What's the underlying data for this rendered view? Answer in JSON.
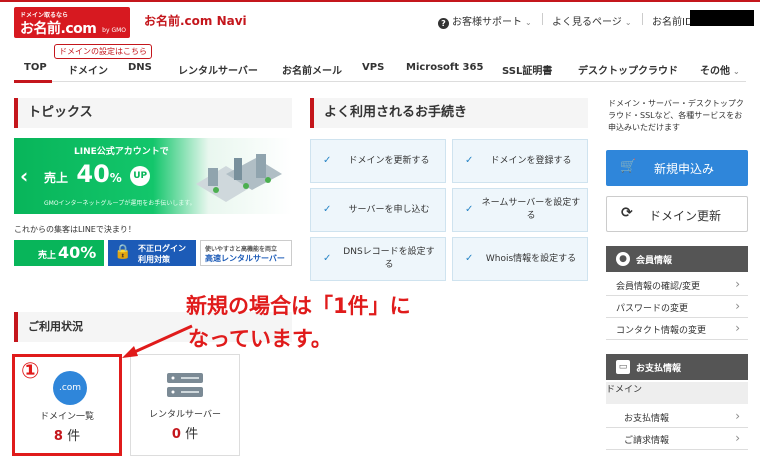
{
  "header": {
    "logo_top": "ドメイン取るなら",
    "logo_main": "お名前.com",
    "logo_sub": "by GMO",
    "app_title": "お名前.com Navi",
    "support_label": "お客様サポート",
    "frequent_label": "よく見るページ",
    "id_label": "お名前ID"
  },
  "domain_tip": "ドメインの設定はこちら",
  "nav": {
    "tabs": [
      "TOP",
      "ドメイン",
      "DNS",
      "レンタルサーバー",
      "お名前メール",
      "VPS",
      "Microsoft 365",
      "SSL証明書",
      "デスクトップクラウド",
      "その他"
    ]
  },
  "topics": {
    "title": "トピックス",
    "banner_line1": "LINE公式アカウントで",
    "banner_line2a": "売上",
    "banner_line2b": "40",
    "banner_line2c": "%",
    "banner_up": "UP",
    "banner_line3": "GMOインターネットグループが運用をお手伝いします。",
    "line_text": "これからの集客はLINEで決まり！",
    "mini1_a": "売上",
    "mini1_b": "40%",
    "mini2_a": "不正ログイン",
    "mini2_b": "利用対策",
    "mini3_a": "使いやすさと高機能を両立",
    "mini3_b": "高速レンタルサーバー"
  },
  "procedures": {
    "title": "よく利用されるお手続き",
    "items": [
      "ドメインを更新する",
      "ドメインを登録する",
      "サーバーを申し込む",
      "ネームサーバーを設定する",
      "DNSレコードを設定する",
      "Whois情報を設定する"
    ]
  },
  "sidebar": {
    "desc": "ドメイン・サーバー・デスクトップクラウド・SSLなど、各種サービスをお申込みいただけます",
    "new_button": "新規申込み",
    "renew_button": "ドメイン更新",
    "member_title": "会員情報",
    "member_items": [
      "会員情報の確認/変更",
      "パスワードの変更",
      "コンタクト情報の変更"
    ],
    "payment_title": "お支払情報",
    "payment_sub": "ドメイン",
    "payment_items": [
      "お支払情報",
      "ご請求情報"
    ]
  },
  "usage": {
    "title": "ご利用状況",
    "cards": [
      {
        "label": "ドメイン一覧",
        "count": "8",
        "unit": "件",
        "icon_text": ".com"
      },
      {
        "label": "レンタルサーバー",
        "count": "0",
        "unit": "件"
      }
    ],
    "marker": "①"
  },
  "annotation": {
    "line1": "新規の場合は「1件」に",
    "line2": "なっています。"
  },
  "colors": {
    "brand_red": "#c4161c",
    "accent_blue": "#2f86da",
    "line_green": "#08b55a",
    "annotation_red": "#e01b1b"
  }
}
